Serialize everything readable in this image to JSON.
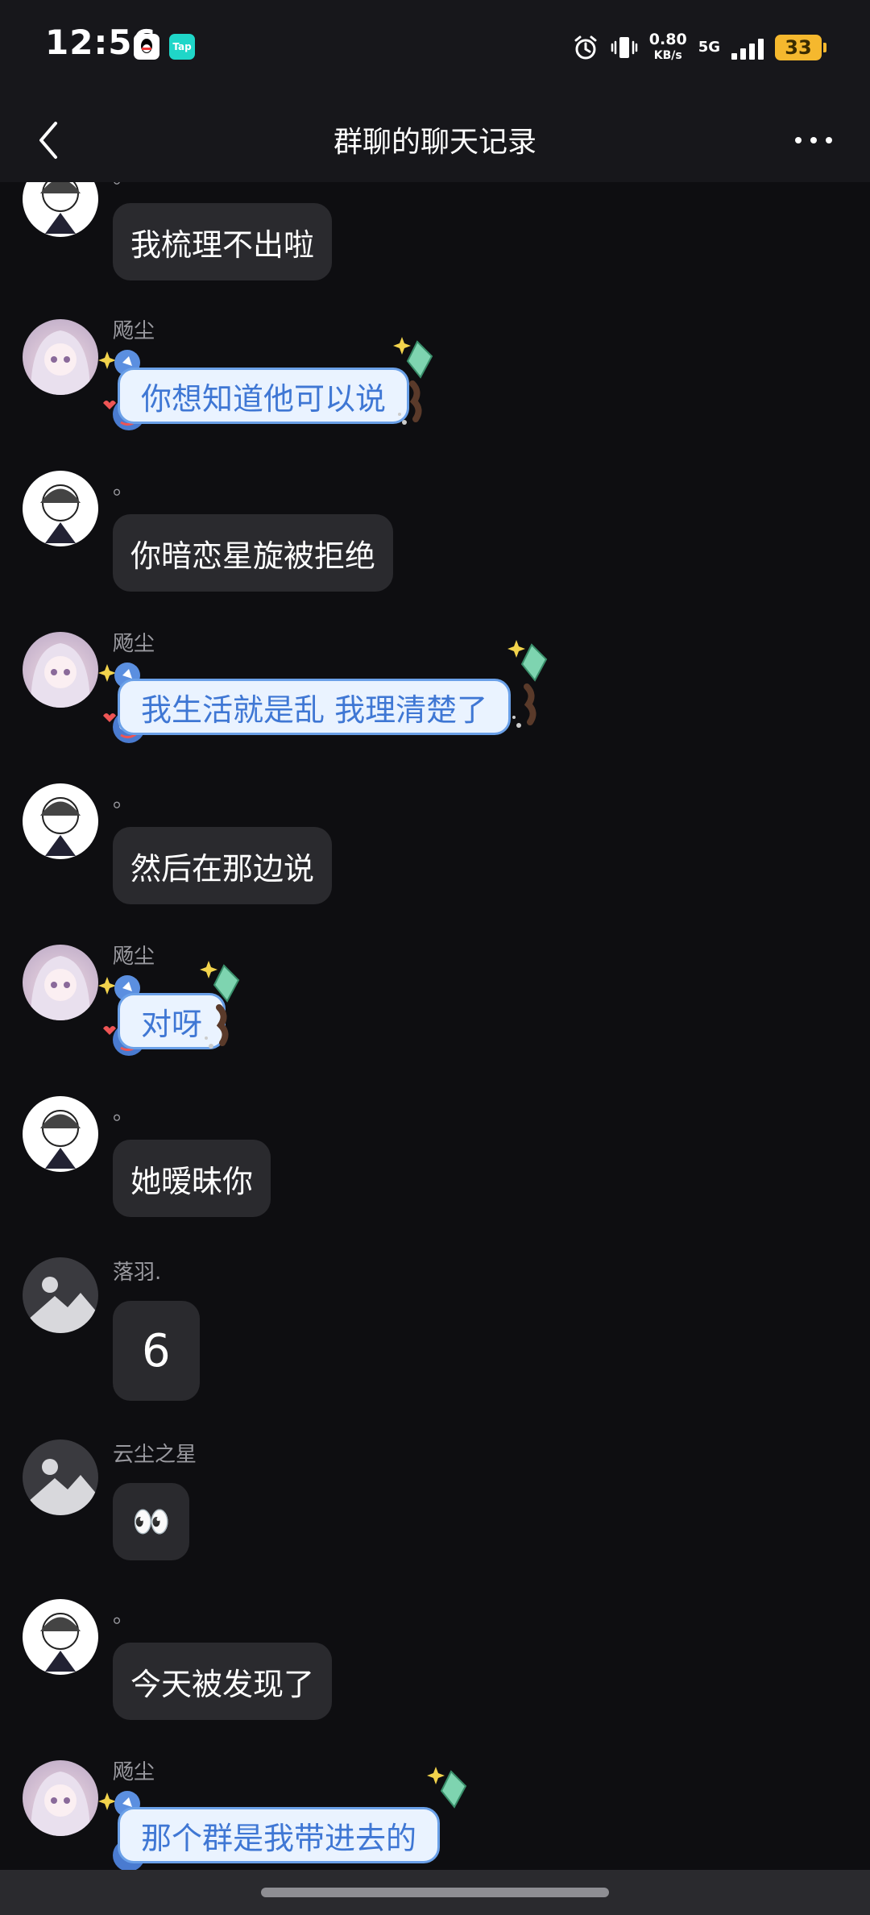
{
  "status_bar": {
    "time": "12:56",
    "qq_icon": "qq-icon",
    "tap_label": "Tap",
    "speed_value": "0.80",
    "speed_unit": "KB/s",
    "network": "5G",
    "battery": "33",
    "battery_color": "#f5b82e"
  },
  "header": {
    "title": "群聊的聊天记录",
    "back_icon": "chevron-left-icon",
    "more_icon": "more-dots-icon"
  },
  "messages": [
    {
      "sender": "。",
      "text": "我梳理不出啦",
      "style": "plain",
      "avatar": "sketch"
    },
    {
      "sender": "飏尘",
      "text": "你想知道他可以说",
      "style": "sticker-bubble",
      "avatar": "girl"
    },
    {
      "sender": "。",
      "text": "你暗恋星旋被拒绝",
      "style": "plain",
      "avatar": "sketch"
    },
    {
      "sender": "飏尘",
      "text": "我生活就是乱  我理清楚了",
      "style": "sticker-bubble",
      "avatar": "girl"
    },
    {
      "sender": "。",
      "text": "然后在那边说",
      "style": "plain",
      "avatar": "sketch"
    },
    {
      "sender": "飏尘",
      "text": "对呀",
      "style": "sticker-bubble",
      "avatar": "girl"
    },
    {
      "sender": "。",
      "text": "她暧昧你",
      "style": "plain",
      "avatar": "sketch"
    },
    {
      "sender": "落羽.",
      "text": "6",
      "style": "plain-big",
      "avatar": "default"
    },
    {
      "sender": "云尘之星",
      "text": "👀",
      "style": "plain",
      "avatar": "default"
    },
    {
      "sender": "。",
      "text": "今天被发现了",
      "style": "plain",
      "avatar": "sketch"
    },
    {
      "sender": "飏尘",
      "text": "那个群是我带进去的",
      "style": "sticker-bubble",
      "avatar": "girl"
    }
  ],
  "colors": {
    "background": "#0e0e11",
    "bubble": "#2a2a2e",
    "sticker_text": "#3f77d4"
  }
}
